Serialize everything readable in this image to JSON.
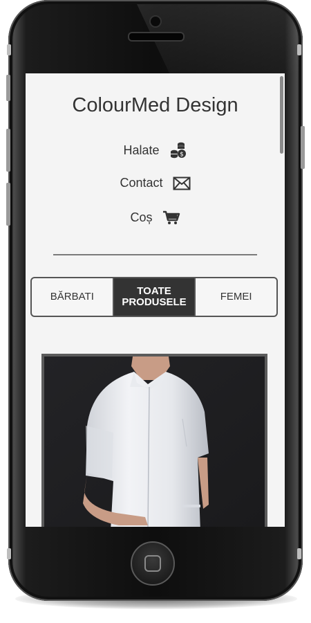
{
  "site": {
    "brand": "ColourMed Design"
  },
  "nav": {
    "items": [
      {
        "label": "Halate",
        "icon": "coins-icon"
      },
      {
        "label": "Contact",
        "icon": "envelope-icon"
      },
      {
        "label": "Coș",
        "icon": "cart-icon"
      }
    ]
  },
  "filters": {
    "men": "BĂRBATI",
    "all": "TOATE PRODUSELE",
    "women": "FEMEI",
    "active": "all"
  },
  "product": {
    "image": "man-in-white-medical-tunic"
  },
  "colors": {
    "screen_bg": "#f4f4f4",
    "text": "#333333",
    "active_tab_bg": "#333333",
    "active_tab_text": "#ffffff",
    "phone_body": "#111111"
  }
}
